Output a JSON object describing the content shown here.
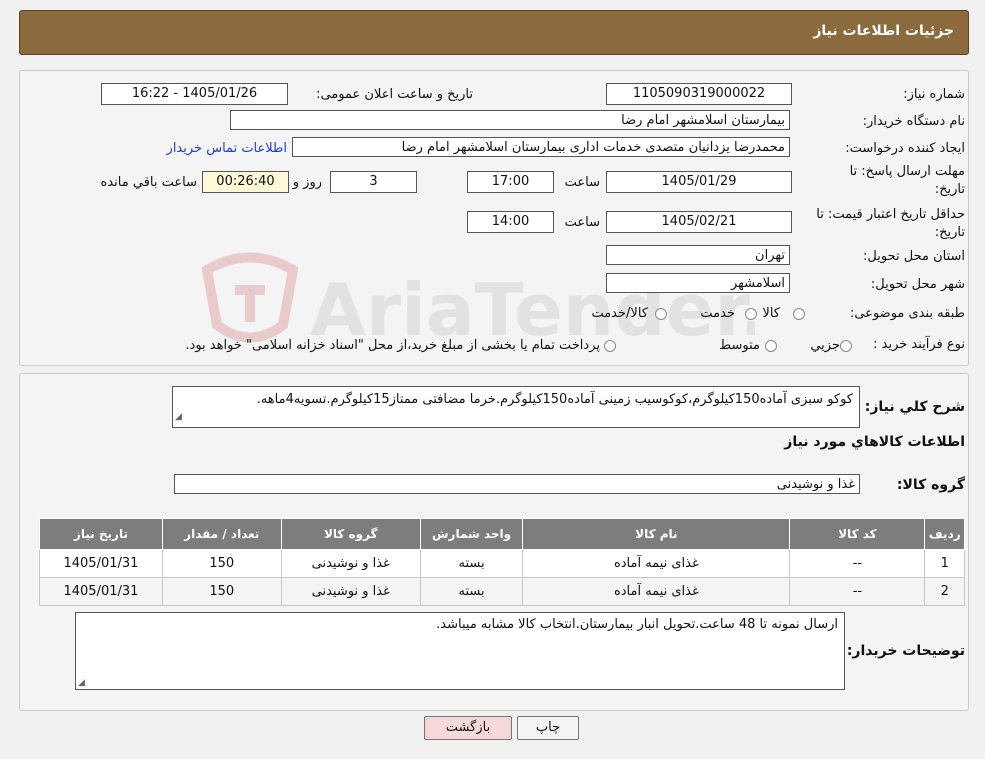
{
  "header": {
    "title": "جزئیات اطلاعات نیاز"
  },
  "form": {
    "need_number_label": "شماره نیاز:",
    "need_number": "1105090319000022",
    "announce_label": "تاریخ و ساعت اعلان عمومی:",
    "announce_value": "1405/01/26 - 16:22",
    "buyer_org_label": "نام دستگاه خریدار:",
    "buyer_org": "بیمارستان اسلامشهر   امام رضا",
    "requester_label": "ایجاد کننده درخواست:",
    "requester": "محمدرضا یزدانیان متصدی خدمات اداری بیمارستان اسلامشهر   امام رضا",
    "contact_link": "اطلاعات تماس خریدار",
    "deadline_label_1": "مهلت ارسال پاسخ: تا",
    "deadline_label_2": "تاریخ:",
    "deadline_date": "1405/01/29",
    "time_label": "ساعت",
    "deadline_time": "17:00",
    "days_value": "3",
    "days_label": "روز و",
    "remaining_time": "00:26:40",
    "remaining_label": "ساعت باقي مانده",
    "validity_label_1": "حداقل تاریخ اعتبار قیمت: تا",
    "validity_label_2": "تاریخ:",
    "validity_date": "1405/02/21",
    "validity_time": "14:00",
    "province_label": "استان محل تحویل:",
    "province": "تهران",
    "city_label": "شهر محل تحویل:",
    "city": "اسلامشهر",
    "category_label": "طبقه بندی موضوعی:",
    "category_options": [
      "کالا",
      "خدمت",
      "کالا/خدمت"
    ],
    "process_label": "نوع فرآیند خرید :",
    "process_options": [
      "جزیي",
      "متوسط"
    ],
    "process_note": "پرداخت تمام یا بخشی از مبلغ خرید،از محل \"اسناد خزانه اسلامی\" خواهد بود."
  },
  "description": {
    "label": "شرح کلي نیاز:",
    "text": "کوکو سبزی آماده150کیلوگرم،کوکوسیب زمینی آماده150کیلوگرم.خرما مضافتی ممتاز15کیلوگرم.تسویه4ماهه."
  },
  "goods": {
    "section_title": "اطلاعات کالاهاي مورد نیاز",
    "group_label": "گروه کالا:",
    "group_value": "غذا و نوشیدنی",
    "columns": [
      "ردیف",
      "کد کالا",
      "نام کالا",
      "واحد شمارش",
      "گروه کالا",
      "تعداد / مقدار",
      "تاریخ نیاز"
    ],
    "rows": [
      [
        "1",
        "--",
        "غذای نیمه آماده",
        "بسته",
        "غذا و نوشیدنی",
        "150",
        "1405/01/31"
      ],
      [
        "2",
        "--",
        "غذای نیمه آماده",
        "بسته",
        "غذا و نوشیدنی",
        "150",
        "1405/01/31"
      ]
    ]
  },
  "buyer_notes": {
    "label": "توضیحات خریدار:",
    "text": "ارسال نمونه تا 48 ساعت.تحویل انبار بیمارستان.انتخاب کالا مشابه میباشد."
  },
  "buttons": {
    "print": "چاپ",
    "back": "بازگشت"
  },
  "watermark": {
    "text": "AriaTender.neT"
  },
  "colors": {
    "header": "#8b6a3e",
    "link": "#1b3fd1",
    "table_header": "#7d7d7d",
    "back_button": "#f7d9d9"
  }
}
